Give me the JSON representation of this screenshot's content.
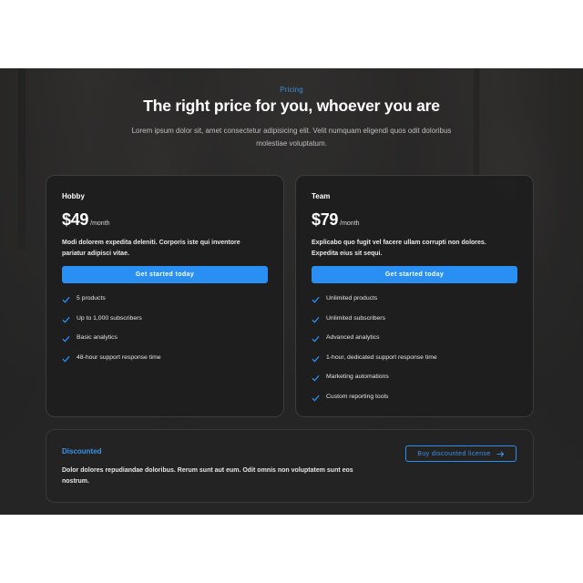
{
  "header": {
    "eyebrow": "Pricing",
    "title": "The right price for you, whoever you are",
    "description": "Lorem ipsum dolor sit, amet consectetur adipisicing elit. Velit numquam eligendi quos odit doloribus molestiae voluptatum."
  },
  "tiers": [
    {
      "name": "Hobby",
      "price": "$49",
      "period": "/month",
      "description": "Modi dolorem expedita deleniti. Corporis iste qui inventore pariatur adipisci vitae.",
      "cta": "Get started today",
      "features": [
        "5 products",
        "Up to 1,000 subscribers",
        "Basic analytics",
        "48-hour support response time"
      ]
    },
    {
      "name": "Team",
      "price": "$79",
      "period": "/month",
      "description": "Explicabo quo fugit vel facere ullam corrupti non dolores. Expedita eius sit sequi.",
      "cta": "Get started today",
      "features": [
        "Unlimited products",
        "Unlimited subscribers",
        "Advanced analytics",
        "1-hour, dedicated support response time",
        "Marketing automations",
        "Custom reporting tools"
      ]
    }
  ],
  "discounted": {
    "title": "Discounted",
    "description": "Dolor dolores repudiandae doloribus. Rerum sunt aut eum. Odit omnis non voluptatem sunt eos nostrum.",
    "cta": "Buy discounted license",
    "cta_icon": "arrow-right-icon"
  },
  "colors": {
    "accent": "#2a8ff2",
    "section_background": "#262626",
    "card_background": "#1e1e1f"
  },
  "icons": {
    "feature_check": "check-icon"
  }
}
